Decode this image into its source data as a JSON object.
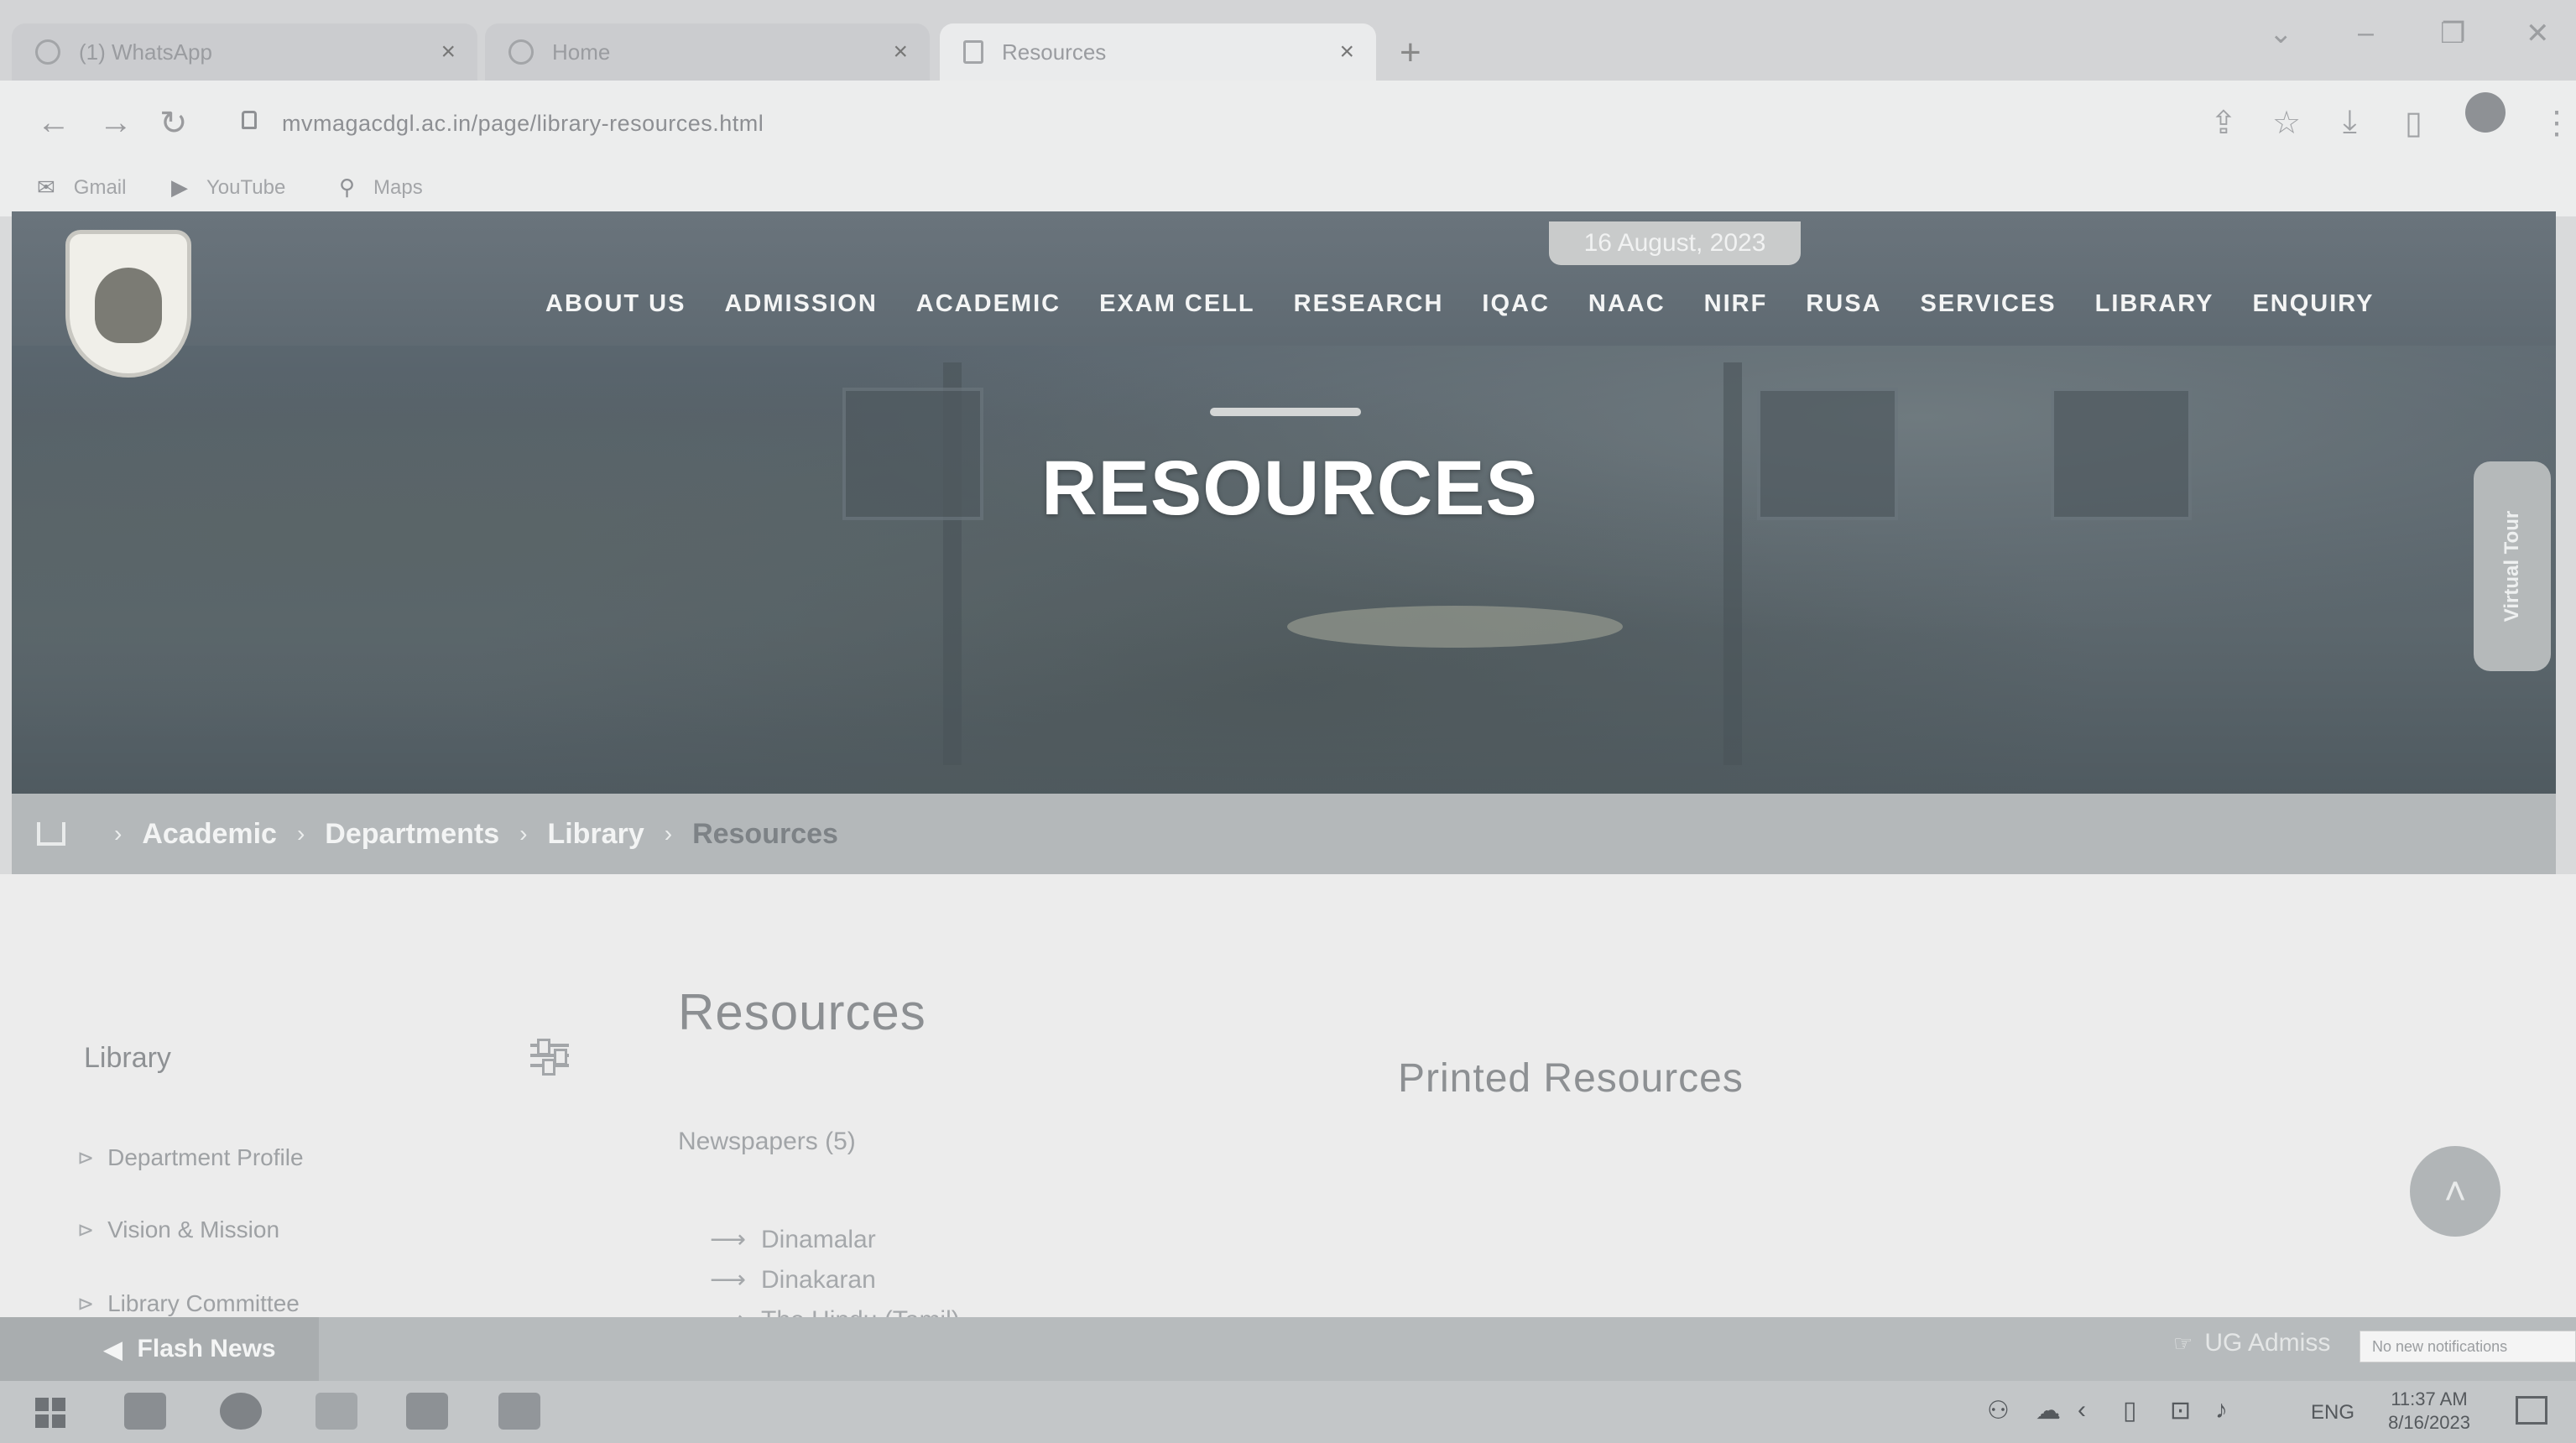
{
  "browser": {
    "tabs": [
      {
        "title": "(1) WhatsApp",
        "active": false
      },
      {
        "title": "Home",
        "active": false
      },
      {
        "title": "Resources",
        "active": true
      }
    ],
    "new_tab_symbol": "+",
    "close_symbol": "×",
    "url": "mvmagacdgl.ac.in/page/library-resources.html",
    "bookmarks": [
      {
        "label": "Gmail",
        "icon": "gmail-icon"
      },
      {
        "label": "YouTube",
        "icon": "youtube-icon"
      },
      {
        "label": "Maps",
        "icon": "maps-icon"
      }
    ]
  },
  "site": {
    "date_badge": "16 August, 2023",
    "nav": [
      "ABOUT US",
      "ADMISSION",
      "ACADEMIC",
      "EXAM CELL",
      "RESEARCH",
      "IQAC",
      "NAAC",
      "NIRF",
      "RUSA",
      "SERVICES",
      "LIBRARY",
      "ENQUIRY"
    ],
    "hero_title": "RESOURCES",
    "virtual_tour": "Virtual Tour",
    "breadcrumb": [
      "Academic",
      "Departments",
      "Library",
      "Resources"
    ]
  },
  "sidebar": {
    "title": "Library",
    "items": [
      "Department Profile",
      "Vision & Mission",
      "Library Committee"
    ]
  },
  "main": {
    "title": "Resources",
    "printed_title": "Printed Resources",
    "newspapers_heading": "Newspapers (5)",
    "newspapers": [
      "Dinamalar",
      "Dinakaran",
      "The Hindu (Tamil)"
    ]
  },
  "flash": {
    "label": "Flash News",
    "ticker": "UG Admiss",
    "notification_tooltip": "No new notifications"
  },
  "taskbar": {
    "language": "ENG",
    "time": "11:37 AM",
    "date": "8/16/2023"
  },
  "colors": {
    "hero_overlay": "#5f6a72",
    "breadcrumb_bar": "#b4b8ba",
    "page_background": "#ececec"
  }
}
